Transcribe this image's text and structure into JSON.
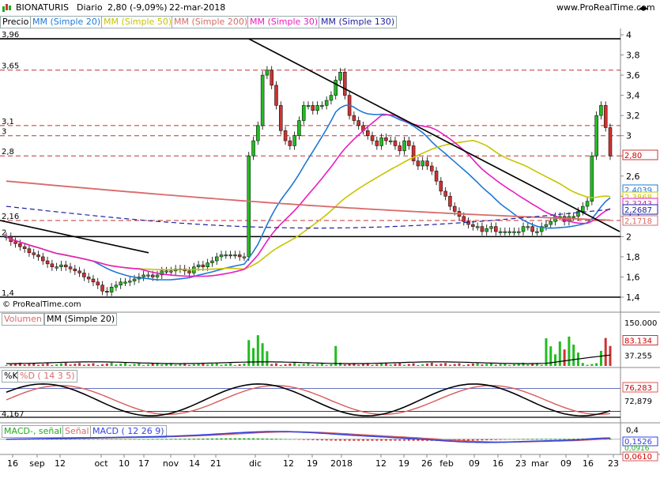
{
  "header": {
    "instrument": "BIONATURIS",
    "period": "Diario",
    "last": "2,80 (-9,09%)",
    "date": "22-mar-2018",
    "site": "www.ProRealTime.com"
  },
  "colors": {
    "mm20": "#1f78d6",
    "mm50": "#c8c400",
    "mm200": "#d96a6a",
    "mm30": "#e81cbe",
    "mm130": "#2020a0",
    "up": "#22bb22",
    "down": "#cc3333",
    "macd": "#3344dd",
    "signal": "#d85a5a",
    "hist": "#22aa22"
  },
  "price_panel": {
    "legend": [
      "Precio",
      "MM (Simple 20)",
      "MM (Simple 50)",
      "MM (Simple 200)",
      "MM (Simple 30)",
      "MM (Simple 130)"
    ],
    "copyright": "© ProRealTime.com",
    "left_levels": [
      "3,96",
      "3,65",
      "3,1",
      "3",
      "2,8",
      "2,16",
      "2",
      "1,4"
    ],
    "y_ticks": [
      "4",
      "3,8",
      "3,6",
      "3,4",
      "3,2",
      "3",
      "2,8",
      "2,6",
      "2,4",
      "2,2",
      "2",
      "1,8",
      "1,6",
      "1,4"
    ],
    "tags": {
      "last": "2,80",
      "mm20": "2,4039",
      "mm50": "2,3868",
      "mm30": "2,3243",
      "mm130": "2,2687",
      "mm200": "2,1718"
    }
  },
  "volume_panel": {
    "legend": [
      "Volumen",
      "MM (Simple 20)"
    ],
    "y_ticks": [
      "150.000",
      "37.255"
    ],
    "tag": "83.134"
  },
  "stoch_panel": {
    "legend": [
      "%K",
      "%D ( 14 3 5)"
    ],
    "left_level": "4,167",
    "tags": {
      "k": "76,283",
      "d": "72,879"
    }
  },
  "macd_panel": {
    "legend": [
      "MACD-, señal",
      "Señal",
      "MACD ( 12 26 9)"
    ],
    "y_ticks": [
      "0,4"
    ],
    "tags": {
      "macd": "0,1526",
      "signal": "0,0916",
      "hist": "0,0610"
    }
  },
  "x_axis": [
    "16",
    "sep",
    "12",
    "oct",
    "10",
    "17",
    "nov",
    "14",
    "21",
    "dic",
    "12",
    "19",
    "2018",
    "12",
    "19",
    "26",
    "feb",
    "09",
    "16",
    "23",
    "mar",
    "09",
    "16",
    "23"
  ],
  "chart_data": {
    "type": "candlestick",
    "title": "BIONATURIS Diario",
    "ylim": [
      1.4,
      4.0
    ],
    "x_range": [
      "aug-2017",
      "mar-2018"
    ],
    "horizontal_levels": [
      3.96,
      3.65,
      3.1,
      3.0,
      2.8,
      2.16,
      2.0,
      1.4
    ],
    "close": [
      2.0,
      1.95,
      1.93,
      1.9,
      1.88,
      1.84,
      1.82,
      1.8,
      1.76,
      1.73,
      1.7,
      1.7,
      1.72,
      1.7,
      1.68,
      1.66,
      1.64,
      1.6,
      1.58,
      1.55,
      1.52,
      1.46,
      1.45,
      1.5,
      1.52,
      1.55,
      1.55,
      1.56,
      1.58,
      1.6,
      1.62,
      1.62,
      1.6,
      1.62,
      1.66,
      1.66,
      1.66,
      1.68,
      1.68,
      1.66,
      1.64,
      1.7,
      1.72,
      1.7,
      1.74,
      1.76,
      1.8,
      1.82,
      1.82,
      1.82,
      1.82,
      1.8,
      1.8,
      2.8,
      2.95,
      3.1,
      3.6,
      3.65,
      3.5,
      3.3,
      3.05,
      2.95,
      2.9,
      3.0,
      3.15,
      3.3,
      3.3,
      3.25,
      3.3,
      3.3,
      3.35,
      3.4,
      3.55,
      3.63,
      3.4,
      3.2,
      3.15,
      3.1,
      3.05,
      3.0,
      2.95,
      2.9,
      2.98,
      2.95,
      2.95,
      2.9,
      2.85,
      2.95,
      2.9,
      2.75,
      2.7,
      2.75,
      2.7,
      2.65,
      2.55,
      2.45,
      2.4,
      2.3,
      2.25,
      2.2,
      2.15,
      2.12,
      2.1,
      2.1,
      2.05,
      2.08,
      2.1,
      2.05,
      2.05,
      2.05,
      2.05,
      2.05,
      2.05,
      2.1,
      2.1,
      2.05,
      2.05,
      2.1,
      2.12,
      2.15,
      2.2,
      2.2,
      2.15,
      2.2,
      2.2,
      2.25,
      2.3,
      2.35,
      2.8,
      3.2,
      3.3,
      3.08,
      2.8
    ],
    "series": [
      {
        "name": "MM (Simple 20)",
        "last": 2.4039
      },
      {
        "name": "MM (Simple 50)",
        "last": 2.3868
      },
      {
        "name": "MM (Simple 200)",
        "last": 2.1718
      },
      {
        "name": "MM (Simple 30)",
        "last": 2.3243
      },
      {
        "name": "MM (Simple 130)",
        "last": 2.2687
      }
    ],
    "volume": {
      "ylim": [
        0,
        150000
      ],
      "mm20_last": 37255,
      "last": 83134
    },
    "stochastic": {
      "k_last": 76.283,
      "d_last": 72.879
    },
    "macd": {
      "macd_last": 0.1526,
      "signal_last": 0.0916,
      "hist_last": 0.061
    }
  }
}
